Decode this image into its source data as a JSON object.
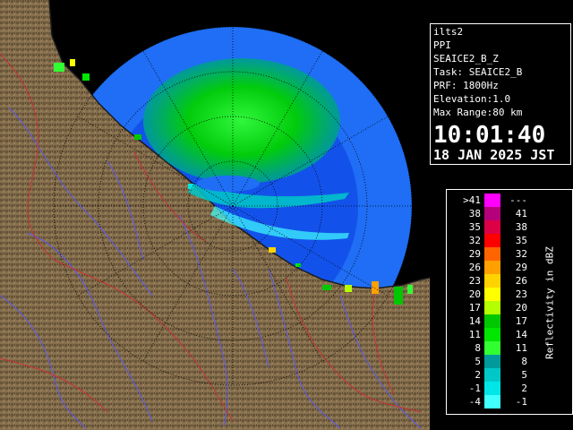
{
  "info": {
    "radar_name": "ilts2",
    "scan_type": "PPI",
    "product": "SEAICE2_B_Z",
    "task": "Task: SEAICE2_B",
    "prf": "PRF: 1800Hz",
    "elevation": "Elevation:1.0",
    "max_range": "Max Range:80 km",
    "time": "10:01:40",
    "date": "18 JAN 2025 JST"
  },
  "legend": {
    "title": "Reflectivity in dBZ",
    "rows": [
      {
        "left": ">41",
        "right": "---",
        "color": "#ff00ff"
      },
      {
        "left": "38",
        "right": "41",
        "color": "#b4007a"
      },
      {
        "left": "35",
        "right": "38",
        "color": "#dc0046"
      },
      {
        "left": "32",
        "right": "35",
        "color": "#ff0000"
      },
      {
        "left": "29",
        "right": "32",
        "color": "#ff6400"
      },
      {
        "left": "26",
        "right": "29",
        "color": "#ffa000"
      },
      {
        "left": "23",
        "right": "26",
        "color": "#ffd200"
      },
      {
        "left": "20",
        "right": "23",
        "color": "#ffff00"
      },
      {
        "left": "17",
        "right": "20",
        "color": "#b4ff00"
      },
      {
        "left": "14",
        "right": "17",
        "color": "#00c800"
      },
      {
        "left": "11",
        "right": "14",
        "color": "#00e600"
      },
      {
        "left": "8",
        "right": "11",
        "color": "#32ff32"
      },
      {
        "left": "5",
        "right": "8",
        "color": "#009a9a"
      },
      {
        "left": "2",
        "right": "5",
        "color": "#00c8c8"
      },
      {
        "left": "-1",
        "right": "2",
        "color": "#00e6e6"
      },
      {
        "left": "-4",
        "right": "-1",
        "color": "#40ffff"
      }
    ]
  },
  "map": {
    "sea_color": "#000000",
    "coverage_color": "#1f6ef5",
    "near_range_color": "#1352ea",
    "land_color": "#6e5a3c",
    "river_color": "#5a5af0",
    "boundary_color": "#c83232",
    "range_rings_km": [
      20,
      40,
      60,
      80
    ]
  }
}
